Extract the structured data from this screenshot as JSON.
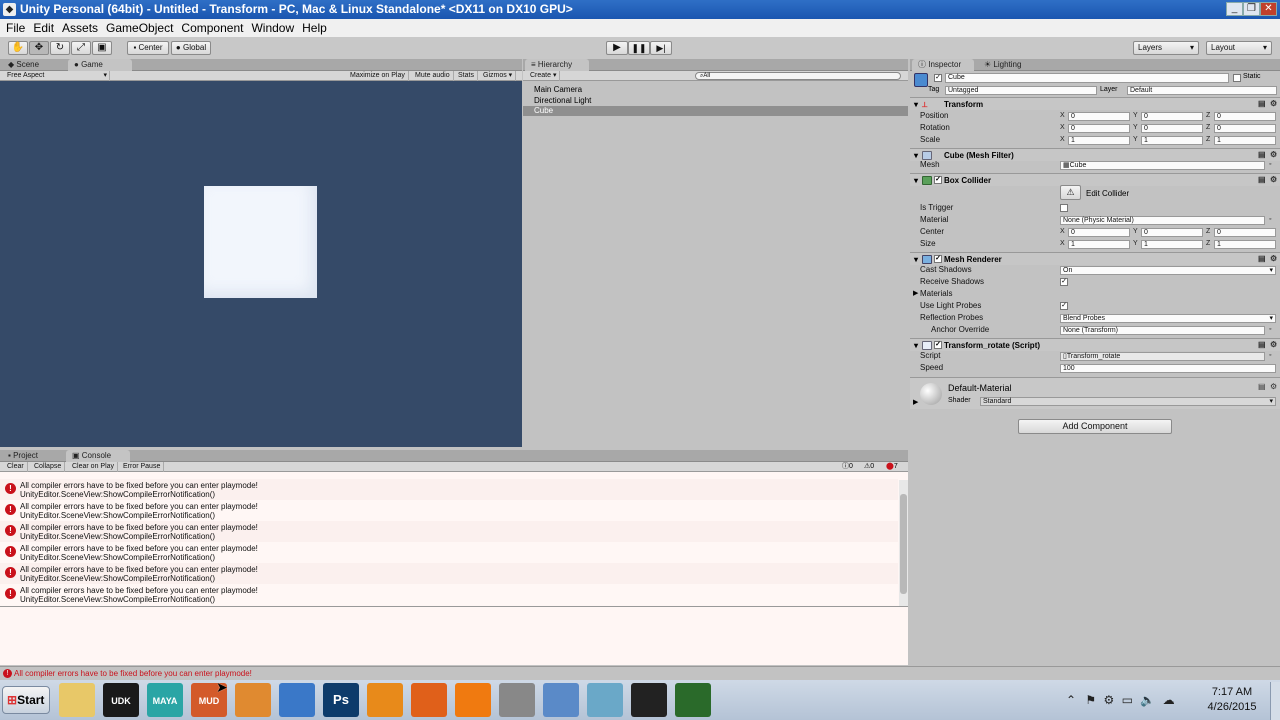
{
  "window": {
    "title": "Unity Personal (64bit) - Untitled - Transform - PC, Mac & Linux Standalone* <DX11 on DX10 GPU>"
  },
  "menu": [
    "File",
    "Edit",
    "Assets",
    "GameObject",
    "Component",
    "Window",
    "Help"
  ],
  "toolbar": {
    "center_label": "Center",
    "global_label": "Global",
    "layers_label": "Layers",
    "layout_label": "Layout"
  },
  "scene_panel": {
    "tabs": [
      "Scene",
      "Game"
    ],
    "aspect": "Free Aspect",
    "options": [
      "Maximize on Play",
      "Mute audio",
      "Stats",
      "Gizmos"
    ],
    "bg_color": "#354a68",
    "cube_color": "#f2f6fc"
  },
  "hierarchy": {
    "tab": "Hierarchy",
    "create_label": "Create",
    "search_placeholder": "All",
    "items": [
      "Main Camera",
      "Directional Light",
      "Cube"
    ],
    "selected": "Cube"
  },
  "inspector": {
    "tabs": [
      "Inspector",
      "Lighting"
    ],
    "object_name": "Cube",
    "static_label": "Static",
    "tag_label": "Tag",
    "tag_value": "Untagged",
    "layer_label": "Layer",
    "layer_value": "Default",
    "transform": {
      "title": "Transform",
      "position_label": "Position",
      "position": [
        "0",
        "0",
        "0"
      ],
      "rotation_label": "Rotation",
      "rotation": [
        "0",
        "0",
        "0"
      ],
      "scale_label": "Scale",
      "scale": [
        "1",
        "1",
        "1"
      ]
    },
    "mesh_filter": {
      "title": "Cube (Mesh Filter)",
      "mesh_label": "Mesh",
      "mesh_value": "Cube"
    },
    "box_collider": {
      "title": "Box Collider",
      "edit_label": "Edit Collider",
      "is_trigger_label": "Is Trigger",
      "material_label": "Material",
      "material_value": "None (Physic Material)",
      "center_label": "Center",
      "center": [
        "0",
        "0",
        "0"
      ],
      "size_label": "Size",
      "size": [
        "1",
        "1",
        "1"
      ]
    },
    "mesh_renderer": {
      "title": "Mesh Renderer",
      "cast_shadows_label": "Cast Shadows",
      "cast_shadows_value": "On",
      "receive_shadows_label": "Receive Shadows",
      "materials_label": "Materials",
      "light_probes_label": "Use Light Probes",
      "reflection_label": "Reflection Probes",
      "reflection_value": "Blend Probes",
      "anchor_label": "Anchor Override",
      "anchor_value": "None (Transform)"
    },
    "script": {
      "title": "Transform_rotate (Script)",
      "script_label": "Script",
      "script_value": "Transform_rotate",
      "speed_label": "Speed",
      "speed_value": "100"
    },
    "material": {
      "title": "Default-Material",
      "shader_label": "Shader",
      "shader_value": "Standard"
    },
    "add_component_label": "Add Component",
    "axes": [
      "X",
      "Y",
      "Z"
    ]
  },
  "console": {
    "tabs": [
      "Project",
      "Console"
    ],
    "buttons": [
      "Clear",
      "Collapse",
      "Clear on Play",
      "Error Pause"
    ],
    "counts": {
      "info": "0",
      "warning": "0",
      "error": "7"
    },
    "messages": [
      {
        "line1": "All compiler errors have to be fixed before you can enter playmode!",
        "line2": "UnityEditor.SceneView:ShowCompileErrorNotification()"
      },
      {
        "line1": "All compiler errors have to be fixed before you can enter playmode!",
        "line2": "UnityEditor.SceneView:ShowCompileErrorNotification()"
      },
      {
        "line1": "All compiler errors have to be fixed before you can enter playmode!",
        "line2": "UnityEditor.SceneView:ShowCompileErrorNotification()"
      },
      {
        "line1": "All compiler errors have to be fixed before you can enter playmode!",
        "line2": "UnityEditor.SceneView:ShowCompileErrorNotification()"
      },
      {
        "line1": "All compiler errors have to be fixed before you can enter playmode!",
        "line2": "UnityEditor.SceneView:ShowCompileErrorNotification()"
      },
      {
        "line1": "All compiler errors have to be fixed before you can enter playmode!",
        "line2": "UnityEditor.SceneView:ShowCompileErrorNotification()"
      }
    ],
    "status": "All compiler errors have to be fixed before you can enter playmode!"
  },
  "taskbar": {
    "start_label": "Start",
    "apps": [
      {
        "name": "file-explorer-icon",
        "label": "",
        "color": "#e8c868"
      },
      {
        "name": "udk-icon",
        "label": "UDK",
        "color": "#1a1a1a"
      },
      {
        "name": "maya-icon",
        "label": "MAYA",
        "color": "#2aa5a5"
      },
      {
        "name": "mudbox-icon",
        "label": "MUD",
        "color": "#d35a2a"
      },
      {
        "name": "app-swirl-icon",
        "label": "",
        "color": "#e08a30"
      },
      {
        "name": "app-pyramid-icon",
        "label": "",
        "color": "#3a78c8"
      },
      {
        "name": "photoshop-icon",
        "label": "Ps",
        "color": "#0d3b6b"
      },
      {
        "name": "blender-icon",
        "label": "",
        "color": "#e88a1a"
      },
      {
        "name": "firefox-icon",
        "label": "",
        "color": "#e0601a"
      },
      {
        "name": "vlc-icon",
        "label": "",
        "color": "#f07a10"
      },
      {
        "name": "app-round-icon",
        "label": "",
        "color": "#888888"
      },
      {
        "name": "app-flower-icon",
        "label": "",
        "color": "#5a8ac8"
      },
      {
        "name": "app-notebook-icon",
        "label": "",
        "color": "#6aa8c8"
      },
      {
        "name": "unity-icon",
        "label": "",
        "color": "#222222"
      },
      {
        "name": "app-excel-icon",
        "label": "",
        "color": "#2a6a2a"
      }
    ],
    "time": "7:17 AM",
    "date": "4/26/2015"
  }
}
